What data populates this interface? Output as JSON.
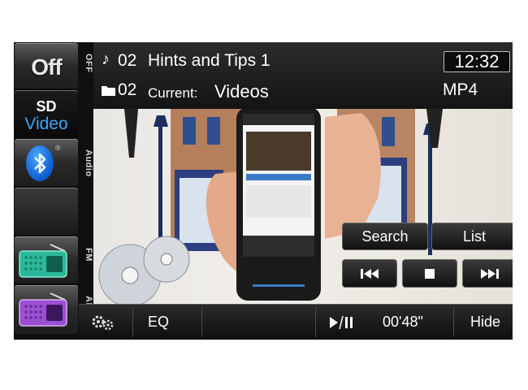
{
  "sources": {
    "off_label": "Off",
    "sd_video": {
      "line1": "SD",
      "line2": "Video"
    },
    "bluetooth_reg": "®",
    "side_labels": [
      "OFF",
      "Audio",
      "FM",
      "AM"
    ]
  },
  "header": {
    "track_number": "02",
    "track_title": "Hints and Tips 1",
    "folder_number": "02",
    "current_label": "Current:",
    "current_value": "Videos",
    "clock": "12:32",
    "format": "MP4"
  },
  "overlay": {
    "search_label": "Search",
    "list_label": "List"
  },
  "bottom_bar": {
    "eq_label": "EQ",
    "elapsed_time": "00'48\"",
    "hide_label": "Hide"
  },
  "colors": {
    "accent_blue": "#3aa7ff",
    "radio_fm": "#2bb89a",
    "radio_am": "#9b4fd3"
  },
  "icons": [
    "note-icon",
    "folder-icon",
    "bluetooth-icon",
    "radio-icon",
    "settings-icon",
    "play-pause-icon",
    "previous-track-icon",
    "stop-icon",
    "next-track-icon"
  ]
}
